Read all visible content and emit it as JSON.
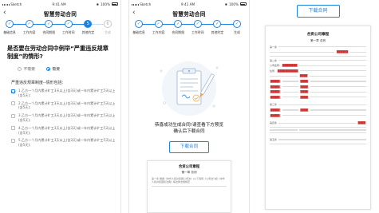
{
  "status": {
    "carrier": "Sketch",
    "time": "9:41 AM",
    "battery": "100%"
  },
  "screen1": {
    "nav_title": "智慧劳动合同",
    "back_icon": "‹",
    "steps": [
      {
        "mark": "✓",
        "label": "基础信息",
        "state": "done"
      },
      {
        "mark": "✓",
        "label": "工作内容",
        "state": "done"
      },
      {
        "mark": "✓",
        "label": "合同期限",
        "state": "done"
      },
      {
        "mark": "✓",
        "label": "工作时间",
        "state": "done"
      },
      {
        "mark": "5",
        "label": "其他约定",
        "state": "cur"
      },
      {
        "mark": "6",
        "label": "生成",
        "state": "todo"
      }
    ],
    "question": "是否要在劳动合同中例举“严重违反规章制度”的情形?",
    "radio_no": "不需要",
    "radio_yes": "需要",
    "conditions_title": "严重违反规章制度--情形包括:",
    "conditions": [
      {
        "num": "1.",
        "text": "乙方一个月内累计旷工3天以上(含3天)或一年内累计旷工5天以上(含5天);",
        "checked": true
      },
      {
        "num": "2.",
        "text": "乙方一个月内累计旷工3天以上(含3天)或一年内累计旷工5天以上(含5天);",
        "checked": false
      },
      {
        "num": "3.",
        "text": "乙方一个月内累计旷工3天以上(含3天)或一年内累计旷工5天以上(含5天);",
        "checked": false
      },
      {
        "num": "4.",
        "text": "乙方一个月内累计旷工3天以上(含3天)或一年内累计旷工5天以上(含5天);",
        "checked": false
      },
      {
        "num": "5.",
        "text": "乙方一个月内累计旷工3天以上(含3天)或一年内累计旷工5天以上(含5天);",
        "checked": false
      }
    ]
  },
  "screen2": {
    "nav_title": "智慧劳动合同",
    "back_icon": "‹",
    "steps": [
      {
        "mark": "✓",
        "label": "基础信息",
        "state": "done"
      },
      {
        "mark": "✓",
        "label": "工作内容",
        "state": "done"
      },
      {
        "mark": "✓",
        "label": "合同期限",
        "state": "done"
      },
      {
        "mark": "✓",
        "label": "工作时间",
        "state": "done"
      },
      {
        "mark": "✓",
        "label": "其他约定",
        "state": "done"
      },
      {
        "mark": "✓",
        "label": "生成",
        "state": "done"
      }
    ],
    "success_line1": "恭喜成功生成合同!请查看下方预览",
    "success_line2": "确认后下载合同",
    "download_label": "下载合同",
    "preview_title": "合资公司章程",
    "preview_chapter": "第一章  总则",
    "preview_para": "第一条  根据《中华人民共和国公司法》(以下简称《公司法》)和《中华人民共和国民法典》等法律法规规定"
  },
  "screen3": {
    "download_label": "下载合同",
    "doc_title": "合资公司章程",
    "doc_chapter": "第一章  总则",
    "clause1": "第一条",
    "clause2": "第二条",
    "clause3": "第三条",
    "clause4": "第四条",
    "clause5": "第五条",
    "company_label": "公司名称:",
    "address_label": "住所:"
  }
}
